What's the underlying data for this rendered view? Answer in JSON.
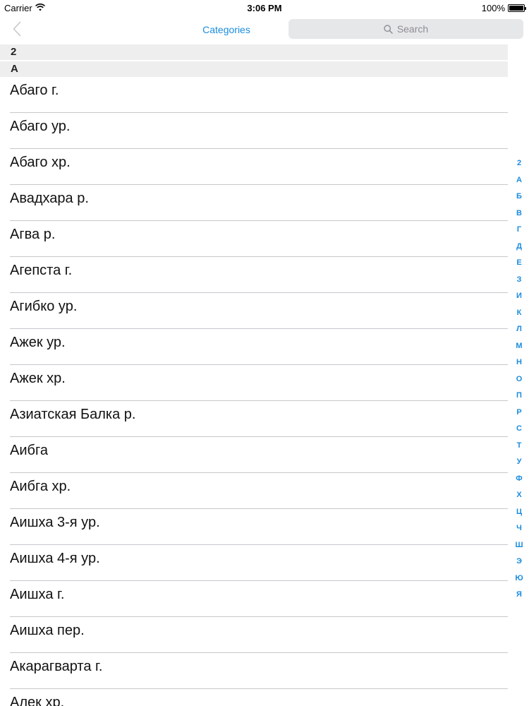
{
  "status_bar": {
    "carrier": "Carrier",
    "time": "3:06 PM",
    "battery": "100%"
  },
  "nav": {
    "title": "Categories",
    "search_placeholder": "Search"
  },
  "sections": [
    "2",
    "А"
  ],
  "rows": [
    "Абаго г.",
    "Абаго ур.",
    "Абаго хр.",
    "Авадхара р.",
    "Агва р.",
    "Агепста г.",
    "Агибко ур.",
    "Ажек ур.",
    "Ажек хр.",
    "Азиатская Балка р.",
    "Аибга",
    "Аибга хр.",
    "Аишха 3-я ур.",
    "Аишха 4-я ур.",
    "Аишха г.",
    "Аишха пер.",
    "Акарагварта г.",
    "Алек хр."
  ],
  "index_letters": [
    "2",
    "А",
    "Б",
    "В",
    "Г",
    "Д",
    "Е",
    "З",
    "И",
    "К",
    "Л",
    "М",
    "Н",
    "О",
    "П",
    "Р",
    "С",
    "Т",
    "У",
    "Ф",
    "Х",
    "Ц",
    "Ч",
    "Ш",
    "Э",
    "Ю",
    "Я"
  ],
  "colors": {
    "accent": "#1a8cde",
    "section_bg": "#eeeeef",
    "separator": "#c8c7cc",
    "search_bg": "#e6e7e9"
  },
  "icons": {
    "back": "chevron-left-icon",
    "search": "search-icon",
    "wifi": "wifi-icon",
    "battery": "battery-icon"
  }
}
